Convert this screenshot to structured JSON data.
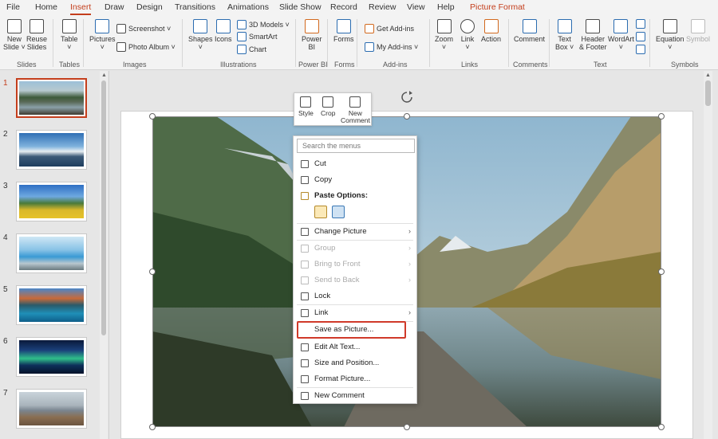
{
  "tabs": [
    "File",
    "Home",
    "Insert",
    "Draw",
    "Design",
    "Transitions",
    "Animations",
    "Slide Show",
    "Record",
    "Review",
    "View",
    "Help",
    "Picture Format"
  ],
  "ribbon": {
    "groups": {
      "slides": "Slides",
      "tables": "Tables",
      "images": "Images",
      "illustrations": "Illustrations",
      "powerbi": "Power BI",
      "forms": "Forms",
      "addins": "Add-ins",
      "links": "Links",
      "comments": "Comments",
      "text": "Text",
      "symbols": "Symbols"
    },
    "buttons": {
      "new_slide": "New",
      "new_slide2": "Slide ˅",
      "reuse": "Reuse",
      "reuse2": "Slides",
      "table": "Table",
      "table2": "˅",
      "pictures": "Pictures",
      "pictures2": "˅",
      "screenshot": "Screenshot ˅",
      "photo_album": "Photo Album ˅",
      "shapes": "Shapes",
      "shapes2": "˅",
      "icons": "Icons",
      "models_3d": "3D Models ˅",
      "smartart": "SmartArt",
      "chart": "Chart",
      "power_bi": "Power",
      "power_bi2": "BI",
      "forms": "Forms",
      "get_addins": "Get Add-ins",
      "my_addins": "My Add-ins ˅",
      "zoom": "Zoom",
      "zoom2": "˅",
      "link": "Link",
      "link2": "˅",
      "action": "Action",
      "comment": "Comment",
      "text_box": "Text",
      "text_box2": "Box ˅",
      "header_footer": "Header",
      "header_footer2": "& Footer",
      "wordart": "WordArt",
      "wordart2": "˅",
      "equation": "Equation",
      "equation2": "˅",
      "symbol": "Symbol"
    }
  },
  "thumbnails": [
    "1",
    "2",
    "3",
    "4",
    "5",
    "6",
    "7"
  ],
  "mini_toolbar": {
    "style": "Style",
    "crop": "Crop",
    "new_comment": "New",
    "new_comment2": "Comment"
  },
  "context_menu": {
    "search_placeholder": "Search the menus",
    "items": {
      "cut": "Cut",
      "copy": "Copy",
      "paste_options": "Paste Options:",
      "change_picture": "Change Picture",
      "group": "Group",
      "bring_to_front": "Bring to Front",
      "send_to_back": "Send to Back",
      "lock": "Lock",
      "link": "Link",
      "save_as_picture": "Save as Picture...",
      "edit_alt_text": "Edit Alt Text...",
      "size_position": "Size and Position...",
      "format_picture": "Format Picture...",
      "new_comment": "New Comment"
    }
  },
  "colors": {
    "accent": "#c43e1c",
    "highlight": "#d03a2a"
  }
}
